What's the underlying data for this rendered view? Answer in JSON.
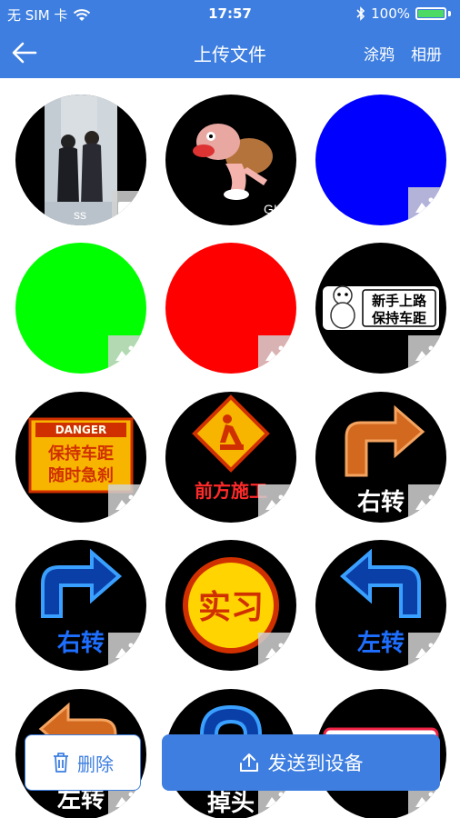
{
  "status_bar": {
    "carrier": "无 SIM 卡",
    "time": "17:57",
    "battery": "100%",
    "battery_level": 1.0,
    "icons": [
      "wifi-icon",
      "bluetooth-icon",
      "battery-icon"
    ]
  },
  "navbar": {
    "back_icon": "arrow-left-icon",
    "title": "上传文件",
    "doodle": "涂鸦",
    "album": "相册"
  },
  "grid": {
    "items": [
      {
        "kind": "video",
        "label": "ss",
        "badge_icon": "video-icon"
      },
      {
        "kind": "gif",
        "label": "GIF",
        "badge_icon": ""
      },
      {
        "kind": "image",
        "color": "#0000ff",
        "badge_icon": "image-icon"
      },
      {
        "kind": "image",
        "color": "#00ff00",
        "badge_icon": "image-icon"
      },
      {
        "kind": "image",
        "color": "#ff0000",
        "badge_icon": "image-icon"
      },
      {
        "kind": "image",
        "lines": [
          "新手上路",
          "保持车距"
        ],
        "badge_icon": "image-icon"
      },
      {
        "kind": "image",
        "header": "DANGER",
        "lines": [
          "保持车距",
          "随时急刹"
        ],
        "badge_icon": "image-icon"
      },
      {
        "kind": "image",
        "caption": "前方施工",
        "badge_icon": "image-icon"
      },
      {
        "kind": "image",
        "caption": "右转",
        "badge_icon": "image-icon"
      },
      {
        "kind": "image",
        "caption": "右转",
        "badge_icon": "image-icon"
      },
      {
        "kind": "image",
        "caption": "实习",
        "badge_icon": "image-icon"
      },
      {
        "kind": "image",
        "caption": "左转",
        "badge_icon": "image-icon"
      },
      {
        "kind": "image",
        "caption": "左转",
        "badge_icon": "image-icon"
      },
      {
        "kind": "image",
        "caption": "掉头",
        "badge_icon": "image-icon"
      },
      {
        "kind": "image",
        "caption": "",
        "badge_icon": "image-icon"
      }
    ]
  },
  "actions": {
    "delete": "删除",
    "send": "发送到设备",
    "delete_icon": "trash-icon",
    "send_icon": "upload-icon"
  },
  "colors": {
    "primary": "#3d7ee0",
    "tile_bg": "#000000"
  }
}
